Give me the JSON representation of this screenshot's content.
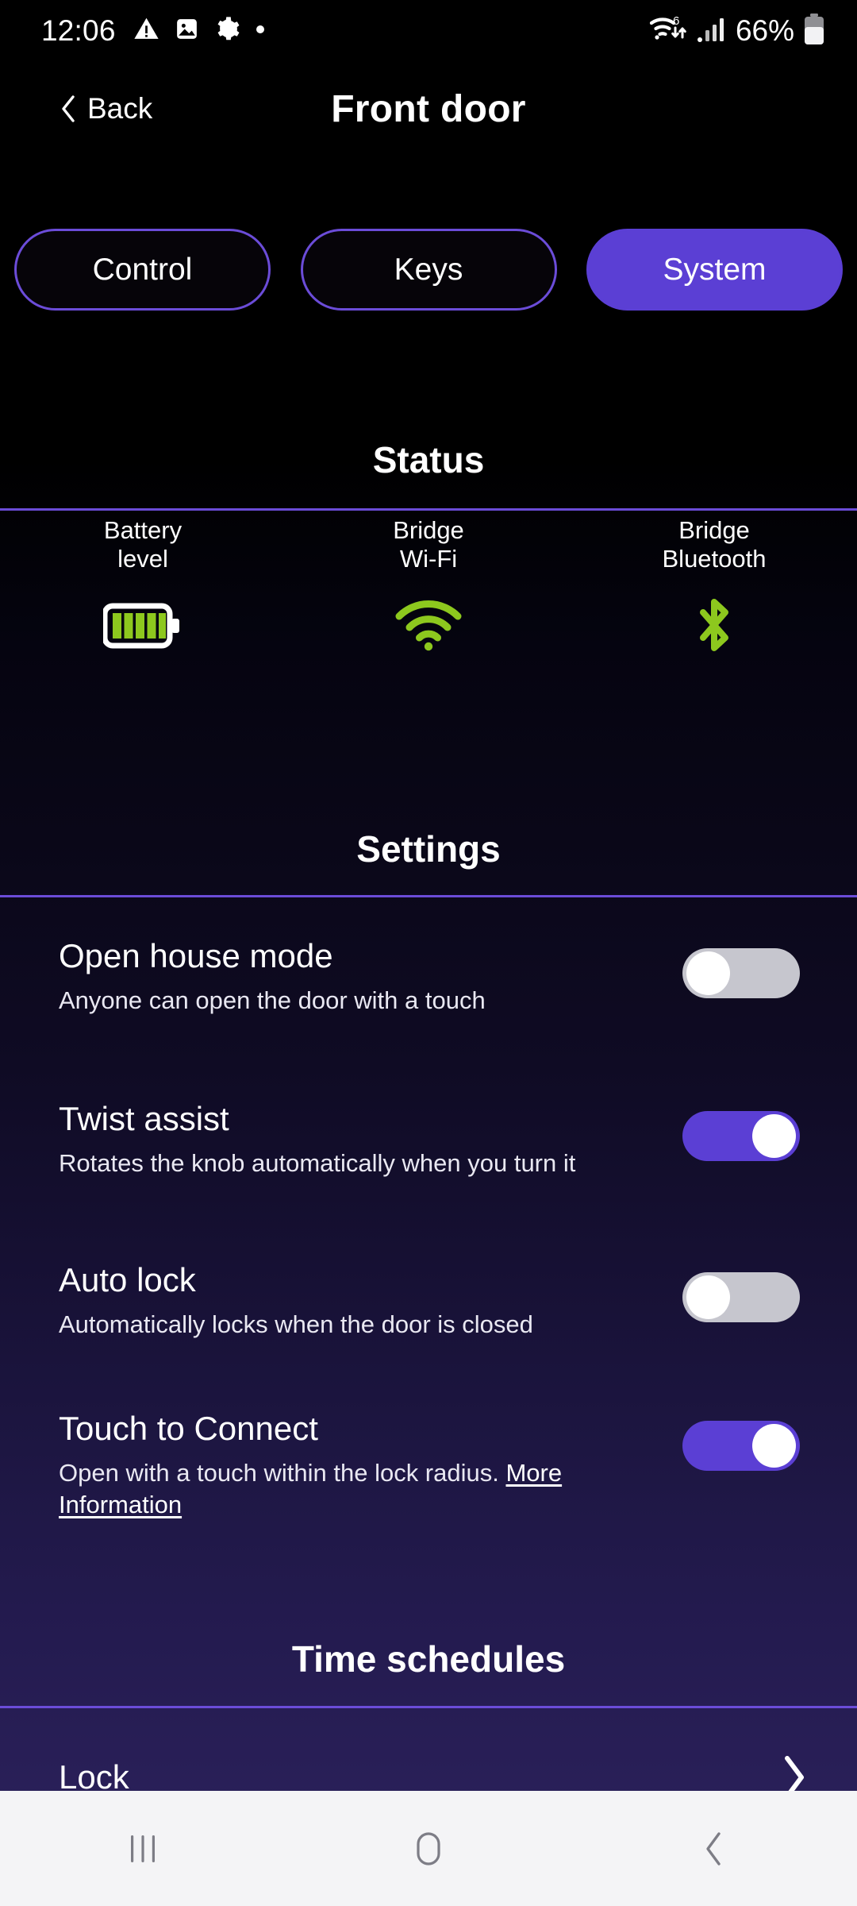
{
  "statusbar": {
    "clock": "12:06",
    "battery_percent": "66%",
    "left_icons": [
      "warning-triangle-icon",
      "image-icon",
      "gear-icon",
      "dot-icon"
    ],
    "right_icons": [
      "wifi6-data-icon",
      "cellular-signal-icon",
      "battery-icon"
    ]
  },
  "header": {
    "back_label": "Back",
    "title": "Front door"
  },
  "tabs": [
    {
      "label": "Control",
      "active": false
    },
    {
      "label": "Keys",
      "active": false
    },
    {
      "label": "System",
      "active": true
    }
  ],
  "status_section": {
    "heading": "Status",
    "items": [
      {
        "label": "Battery\nlevel",
        "icon": "battery-full-icon",
        "state": "full"
      },
      {
        "label": "Bridge\nWi-Fi",
        "icon": "wifi-icon",
        "state": "connected"
      },
      {
        "label": "Bridge\nBluetooth",
        "icon": "bluetooth-icon",
        "state": "connected"
      }
    ]
  },
  "settings_section": {
    "heading": "Settings",
    "rows": [
      {
        "title": "Open house mode",
        "subtitle": "Anyone can open the door with a touch",
        "toggle": "off"
      },
      {
        "title": "Twist assist",
        "subtitle": "Rotates the knob automatically when you turn it",
        "toggle": "on"
      },
      {
        "title": "Auto lock",
        "subtitle": "Automatically locks when the door is closed",
        "toggle": "off"
      },
      {
        "title": "Touch to Connect",
        "subtitle": "Open with a touch within the lock radius. ",
        "link": "More Information",
        "toggle": "on"
      }
    ]
  },
  "schedules_section": {
    "heading": "Time schedules",
    "rows": [
      {
        "label": "Lock",
        "chevron": "chevron-right-icon"
      }
    ]
  },
  "navbar": {
    "recents_label": "recents-icon",
    "home_label": "home-icon",
    "back_label": "back-icon"
  },
  "colors": {
    "accent_purple": "#5b3fd4",
    "accent_border": "#6b4cd8",
    "status_green": "#8dc81e",
    "toggle_off": "#c6c6ce",
    "background_top": "#000000",
    "background_bottom": "#2b2159"
  }
}
